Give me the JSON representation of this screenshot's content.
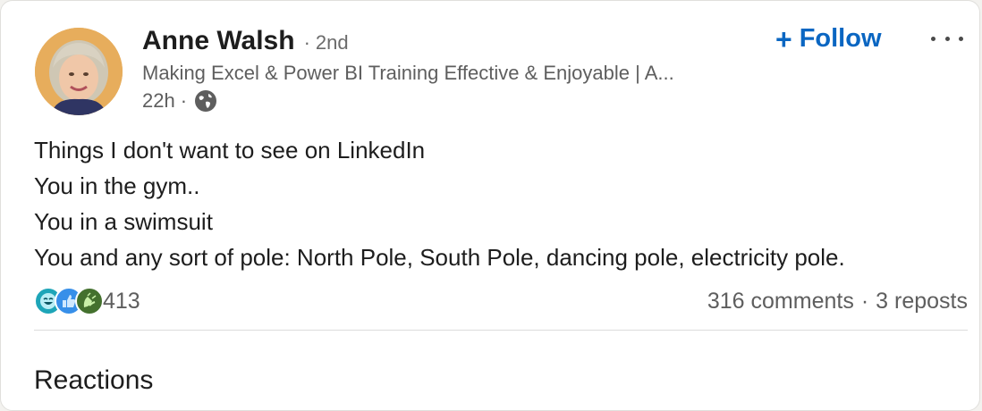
{
  "post": {
    "author_name": "Anne Walsh",
    "degree": "2nd",
    "headline": "Making Excel & Power BI Training Effective & Enjoyable | A...",
    "time": "22h",
    "visibility_icon": "globe-icon",
    "follow_plus": "+",
    "follow_label": "Follow",
    "more_icon": "more-options-icon",
    "body_lines": [
      "Things I don't want to see on LinkedIn",
      "You in the gym..",
      "You in a swimsuit",
      "You and any sort of pole: North Pole, South Pole, dancing pole, electricity pole."
    ]
  },
  "social": {
    "reaction_icons": [
      "funny-reaction-icon",
      "like-reaction-icon",
      "celebrate-reaction-icon"
    ],
    "reaction_count": "413",
    "comments": "316 comments",
    "dot": "·",
    "reposts": "3 reposts"
  },
  "section": {
    "title": "Reactions"
  },
  "colors": {
    "accent": "#0a66c2",
    "secondary_text": "#5e5e5e",
    "like": "#378fe9",
    "celebrate": "#44712e",
    "funny": "#1ea5b8"
  },
  "sep": "·"
}
